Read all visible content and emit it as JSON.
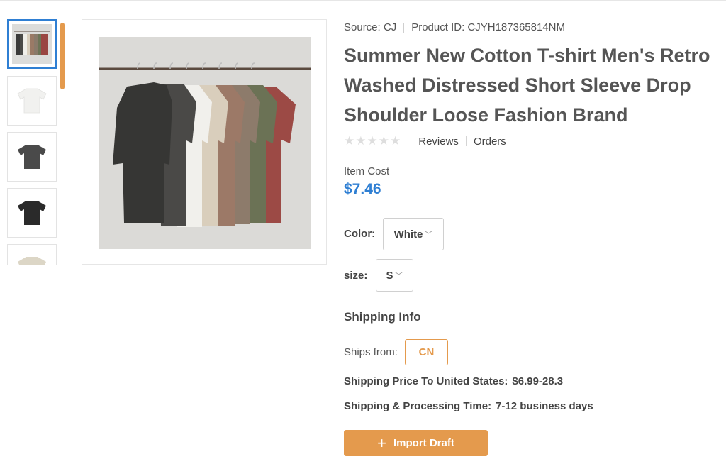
{
  "colors": {
    "accent": "#e49a4d",
    "price": "#2f7fd3",
    "active_thumb": "#2f7fd3"
  },
  "thumbnails": [
    {
      "name": "rack-of-tshirts",
      "selected": true
    },
    {
      "name": "white-tshirt",
      "selected": false
    },
    {
      "name": "dark-gray-tshirt",
      "selected": false
    },
    {
      "name": "black-tshirt",
      "selected": false
    },
    {
      "name": "beige-tshirt",
      "selected": false
    }
  ],
  "meta": {
    "source": "Source: CJ",
    "product_id": "Product ID: CJYH187365814NM"
  },
  "title": "Summer New Cotton T-shirt Men's Retro Washed Distressed Short Sleeve Drop Shoulder Loose Fashion Brand",
  "rating": {
    "stars": 0,
    "reviews_label": "Reviews",
    "orders_label": "Orders"
  },
  "cost": {
    "label": "Item Cost",
    "price": "$7.46"
  },
  "options": {
    "color_label": "Color:",
    "color_value": "White",
    "size_label": "size:",
    "size_value": "S"
  },
  "shipping": {
    "title": "Shipping Info",
    "ships_from_label": "Ships from:",
    "ships_from_value": "CN",
    "price_label": "Shipping Price To United States:",
    "price_value": "$6.99-28.3",
    "time_label": "Shipping & Processing Time:",
    "time_value": "7-12 business days"
  },
  "import_button": {
    "label": "Import Draft",
    "icon": "plus-icon"
  }
}
